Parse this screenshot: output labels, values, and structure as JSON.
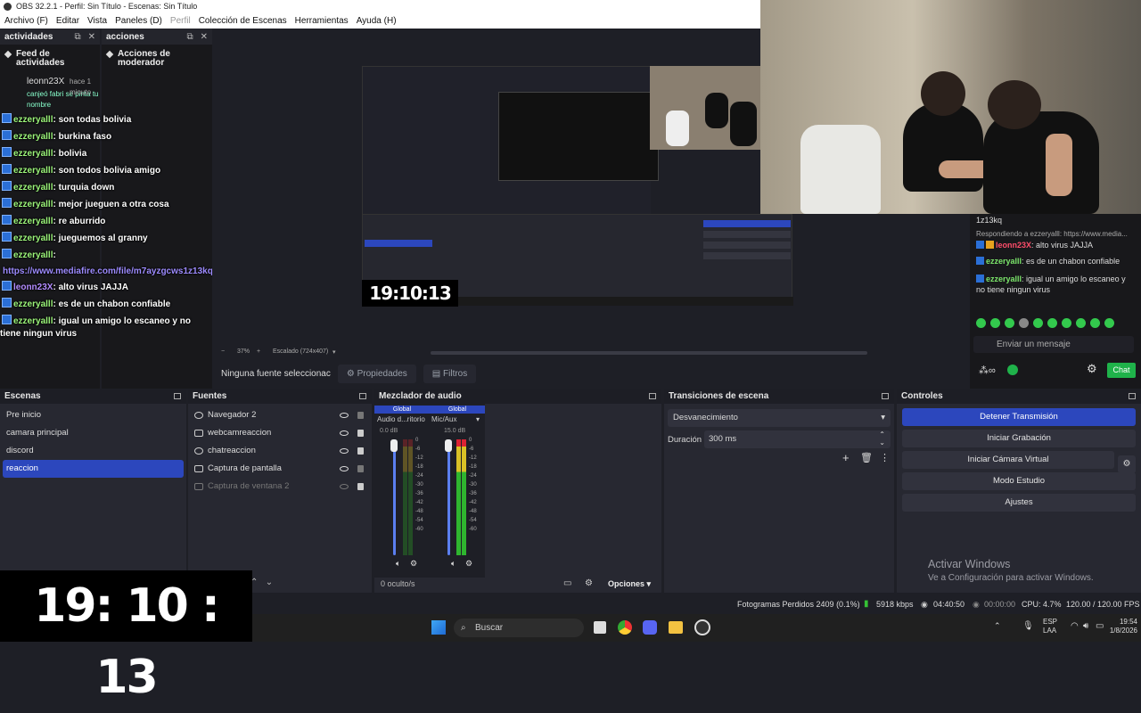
{
  "window": {
    "title": "OBS 32.2.1 - Perfil: Sin Título - Escenas: Sin Título"
  },
  "menu": [
    "Archivo (F)",
    "Editar",
    "Vista",
    "Paneles (D)",
    "Perfil",
    "Colección de Escenas",
    "Herramientas",
    "Ayuda (H)"
  ],
  "docks": {
    "activity_title": "actividades",
    "actions_title": "acciones",
    "feed_title": "Feed de actividades",
    "mod_title": "Acciones de moderador",
    "feed_item": {
      "user": "leonn23X",
      "time": "hace 1 minuto",
      "sub": "canjeó fabri se pinta tu nombre"
    }
  },
  "chat_overlay": [
    {
      "user": "ezzeryalll",
      "text": ": son todas bolivia"
    },
    {
      "user": "ezzeryalll",
      "text": ": burkina faso"
    },
    {
      "user": "ezzeryalll",
      "text": ": bolivia"
    },
    {
      "user": "ezzeryalll",
      "text": ": son todos bolivia amigo"
    },
    {
      "user": "ezzeryalll",
      "text": ": turquia down"
    },
    {
      "user": "ezzeryalll",
      "text": ": mejor jueguen a otra cosa"
    },
    {
      "user": "ezzeryalll",
      "text": ": re aburrido"
    },
    {
      "user": "ezzeryalll",
      "text": ": jueguemos al granny"
    },
    {
      "user": "ezzeryalll",
      "text": ":"
    }
  ],
  "chat_link": "https://www.mediafire.com/file/m7ayzgcws1z13kq",
  "chat_overlay2": [
    {
      "user": "leonn23X",
      "text": ": alto virus JAJJA",
      "cls": "user2"
    },
    {
      "user": "ezzeryalll",
      "text": ": es de un chabon confiable",
      "cls": "user"
    },
    {
      "user": "ezzeryalll",
      "text": ": igual un amigo lo escaneo y no tiene ningun virus",
      "cls": "user"
    }
  ],
  "preview": {
    "clock": "19:10:13",
    "zoom": "37%",
    "scale_label": "Escalado (724x407)",
    "no_source": "Ninguna fuente seleccionac",
    "props": "Propiedades",
    "filters": "Filtros"
  },
  "right_chat": {
    "top": "1z13kq",
    "reply": "Respondiendo a ezzeryalll: https://www.media...",
    "lines": [
      {
        "user": "leonn23X",
        "text": ": alto virus JAJJA",
        "cls": "u1"
      },
      {
        "user": "ezzeryalll",
        "text": ": es de un chabon confiable",
        "cls": "u2"
      },
      {
        "user": "ezzeryalll",
        "text": ": igual un amigo lo escaneo y no tiene ningun virus",
        "cls": "u2"
      }
    ],
    "placeholder": "Enviar un mensaje",
    "chat_button": "Chat"
  },
  "scenes": {
    "title": "Escenas",
    "items": [
      "Pre inicio",
      "camara principal",
      "discord",
      "reaccion"
    ],
    "selected": 3
  },
  "sources": {
    "title": "Fuentes",
    "items": [
      "Navegador 2",
      "webcamreaccion",
      "chatreaccion",
      "Captura de pantalla",
      "Captura de ventana 2"
    ]
  },
  "mixer": {
    "title": "Mezclador de audio",
    "channels": [
      {
        "tag": "Global",
        "name": "Audio d...ritorio",
        "db": "0.0 dB",
        "level": 0.85
      },
      {
        "tag": "Global",
        "name": "Mic/Aux",
        "db": "15.0 dB",
        "level": 0.72
      }
    ],
    "scale": [
      "0",
      "-6",
      "-12",
      "-18",
      "-24",
      "-30",
      "-36",
      "-42",
      "-48",
      "-54",
      "-60"
    ],
    "hidden": "0 oculto/s",
    "options": "Opciones"
  },
  "transitions": {
    "title": "Transiciones de escena",
    "selected": "Desvanecimiento",
    "duration_label": "Duración",
    "duration_value": "300 ms"
  },
  "controls": {
    "title": "Controles",
    "buttons": [
      "Detener Transmisión",
      "Iniciar Grabación",
      "Iniciar Cámara Virtual",
      "Modo Estudio",
      "Ajustes"
    ]
  },
  "watermark": {
    "line1": "Activar Windows",
    "line2": "Ve a Configuración para activar Windows."
  },
  "status": {
    "frames": "Fotogramas Perdidos 2409 (0.1%)",
    "bitrate": "5918 kbps",
    "stream_time": "04:40:50",
    "rec_time": "00:00:00",
    "cpu": "CPU: 4.7%",
    "fps": "120.00 / 120.00 FPS"
  },
  "taskbar": {
    "search": "Buscar",
    "lang": "ESP",
    "lang2": "LAA",
    "time": "19:54",
    "date": "1/8/2026"
  },
  "clock_big": "19: 10 : 13"
}
